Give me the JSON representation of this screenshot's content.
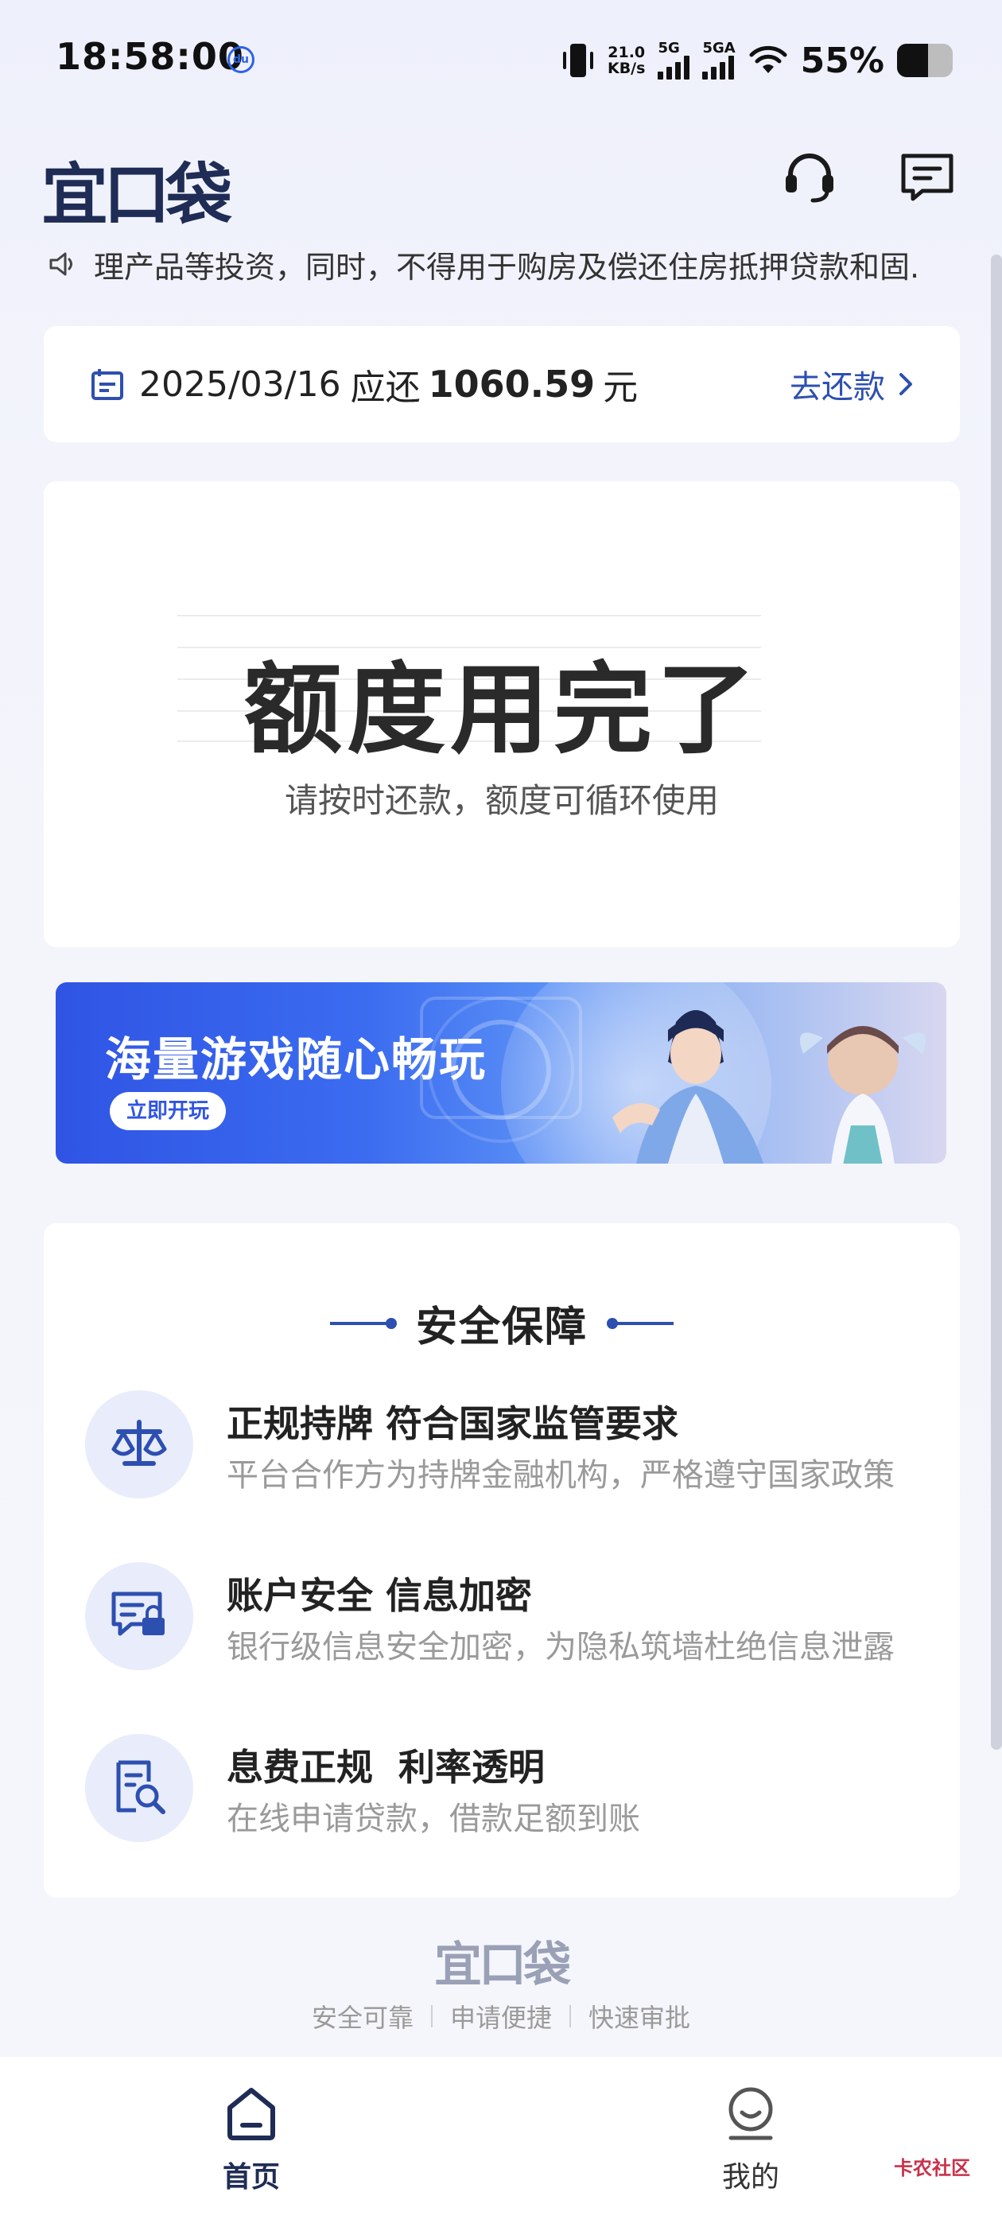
{
  "status_bar": {
    "time": "18:58:00",
    "net_speed_value": "21.0",
    "net_speed_unit": "KB/s",
    "sim1_label": "5G",
    "sim2_label": "5GA",
    "battery_text": "55%",
    "battery_level": 0.55
  },
  "header": {
    "logo_text": "宜口袋",
    "support_icon": "headset-icon",
    "message_icon": "message-icon"
  },
  "notice": {
    "icon": "speaker-icon",
    "text": "理产品等投资，同时，不得用于购房及偿还住房抵押贷款和固."
  },
  "repayment": {
    "date": "2025/03/16",
    "due_label": "应还",
    "amount": "1060.59",
    "currency": "元",
    "action_label": "去还款"
  },
  "credit": {
    "title": "额度用完了",
    "subtitle": "请按时还款，额度可循环使用"
  },
  "banner": {
    "title": "海量游戏随心畅玩",
    "button_label": "立即开玩"
  },
  "security": {
    "title": "安全保障",
    "items": [
      {
        "icon": "scale-icon",
        "heading": "正规持牌 符合国家监管要求",
        "desc": "平台合作方为持牌金融机构，严格遵守国家政策"
      },
      {
        "icon": "secure-chat-icon",
        "heading": "账户安全 信息加密",
        "desc": "银行级信息安全加密，为隐私筑墙杜绝信息泄露"
      },
      {
        "icon": "document-search-icon",
        "heading": "息费正规  利率透明",
        "desc": "在线申请贷款，借款足额到账"
      }
    ]
  },
  "footer": {
    "logo_text": "宜口袋",
    "tags": [
      "安全可靠",
      "申请便捷",
      "快速审批"
    ]
  },
  "tabbar": {
    "home_label": "首页",
    "mine_label": "我的"
  },
  "watermark": "卡农社区"
}
